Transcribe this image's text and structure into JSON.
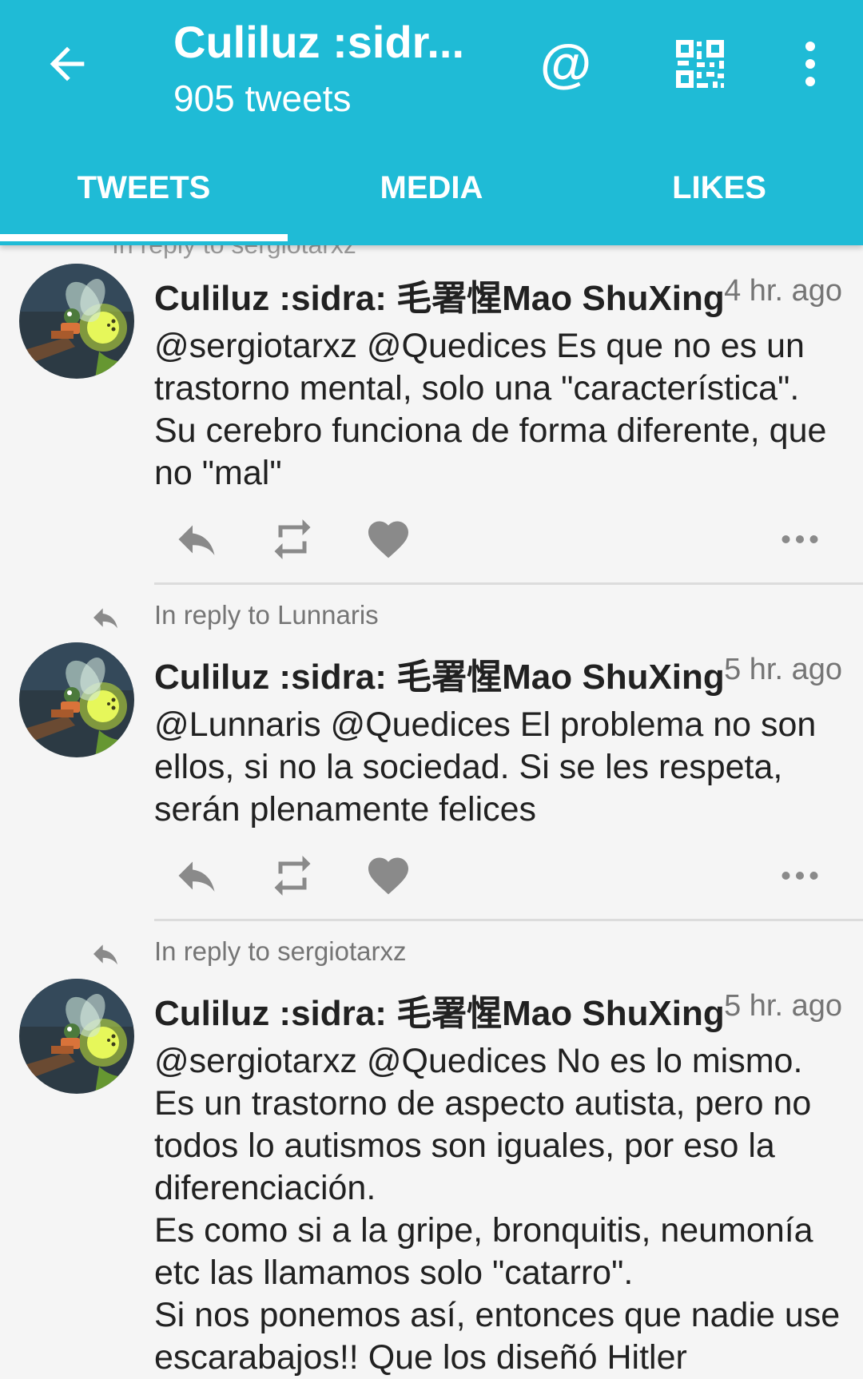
{
  "header": {
    "title": "Culiluz :sidr...",
    "subtitle": "905 tweets",
    "mention_label": "@",
    "icons": [
      "back-arrow-icon",
      "at-icon",
      "qr-code-icon",
      "more-vert-icon"
    ]
  },
  "tabs": [
    {
      "label": "TWEETS",
      "selected": true
    },
    {
      "label": "MEDIA",
      "selected": false
    },
    {
      "label": "LIKES",
      "selected": false
    }
  ],
  "partial_reply": "In reply to sergiotarxz",
  "tweets": [
    {
      "author": "Culiluz :sidra: 毛署惺Mao ShuXing",
      "time": "4 hr. ago",
      "in_reply_to": "",
      "text": "@sergiotarxz @Quedices Es que no es un trastorno mental, solo una \"característica\". Su cerebro funciona de forma diferente, que no \"mal\""
    },
    {
      "author": "Culiluz :sidra: 毛署惺Mao ShuXing",
      "time": "5 hr. ago",
      "in_reply_to": "In reply to Lunnaris",
      "text": "@Lunnaris @Quedices El problema no son ellos, si no la sociedad. Si se les respeta, serán plenamente felices"
    },
    {
      "author": "Culiluz :sidra: 毛署惺Mao ShuXing",
      "time": "5 hr. ago",
      "in_reply_to": "In reply to sergiotarxz",
      "text": "@sergiotarxz @Quedices No es lo mismo.\nEs un trastorno de aspecto autista, pero no todos lo autismos son iguales, por eso la diferenciación.\nEs como si a la gripe, bronquitis, neumonía etc las llamamos solo \"catarro\".\nSi nos ponemos así, entonces que nadie use escarabajos!! Que los diseñó Hitler"
    }
  ],
  "colors": {
    "accent": "#1fbbd6",
    "text": "#212121",
    "secondary_text": "#757575",
    "icon": "#8a8a8a",
    "background": "#f5f5f5"
  }
}
